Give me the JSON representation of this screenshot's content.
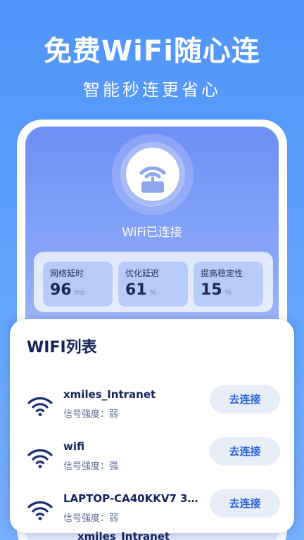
{
  "hero": {
    "title": "免费WiFi随心连",
    "subtitle": "智能秒连更省心"
  },
  "preview": {
    "status_text": "WiFi已连接",
    "stats": [
      {
        "label": "网络延时",
        "value": "96",
        "unit": "ms"
      },
      {
        "label": "优化延迟",
        "value": "61",
        "unit": "%"
      },
      {
        "label": "提高稳定性",
        "value": "15",
        "unit": "%"
      }
    ]
  },
  "wifi_list": {
    "title": "WIFI列表",
    "connect_label": "去连接",
    "items": [
      {
        "name": "xmiles_Intranet",
        "strength": "信号强度：弱"
      },
      {
        "name": "wifi",
        "strength": "信号强度：强"
      },
      {
        "name": "LAPTOP-CA40KKV7 35…",
        "strength": "信号强度：弱"
      },
      {
        "name": "xmiles_Intranet",
        "strength": ""
      }
    ]
  },
  "colors": {
    "background": "#5d9ffb",
    "accent": "#2e66d6",
    "dark_text": "#14245a",
    "icon_navy": "#1c2f6e"
  }
}
